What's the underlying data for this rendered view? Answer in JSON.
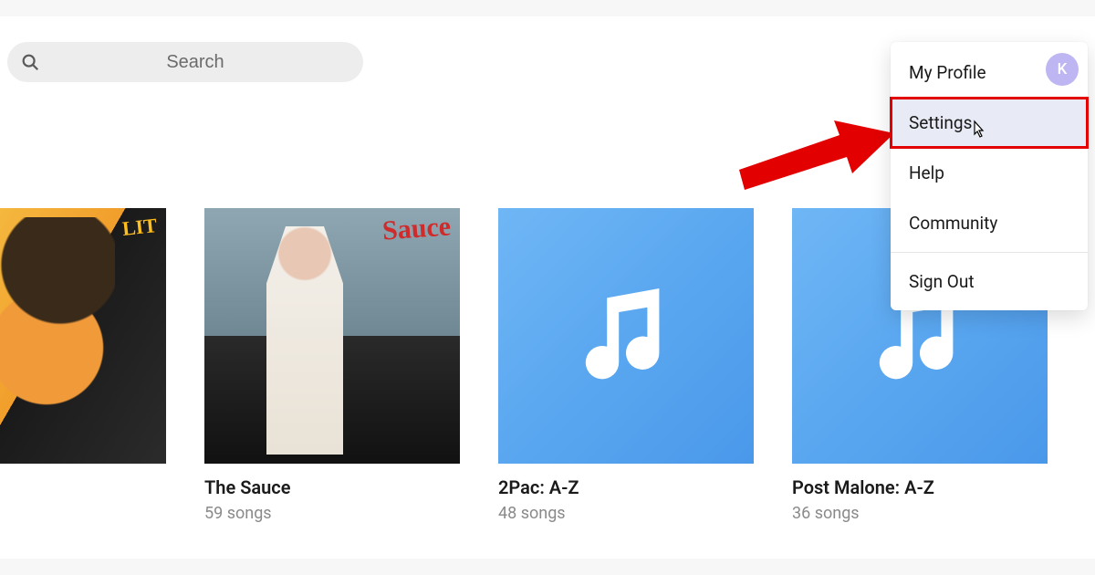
{
  "search": {
    "placeholder": "Search"
  },
  "avatar": {
    "initial": "K"
  },
  "menu": {
    "items": [
      {
        "label": "My Profile"
      },
      {
        "label": "Settings"
      },
      {
        "label": "Help"
      },
      {
        "label": "Community"
      },
      {
        "label": "Sign Out"
      }
    ]
  },
  "playlists": [
    {
      "title": "",
      "songs": ""
    },
    {
      "title": "The Sauce",
      "songs": "59 songs"
    },
    {
      "title": "2Pac: A-Z",
      "songs": "48 songs"
    },
    {
      "title": "Post Malone: A-Z",
      "songs": "36 songs"
    }
  ]
}
